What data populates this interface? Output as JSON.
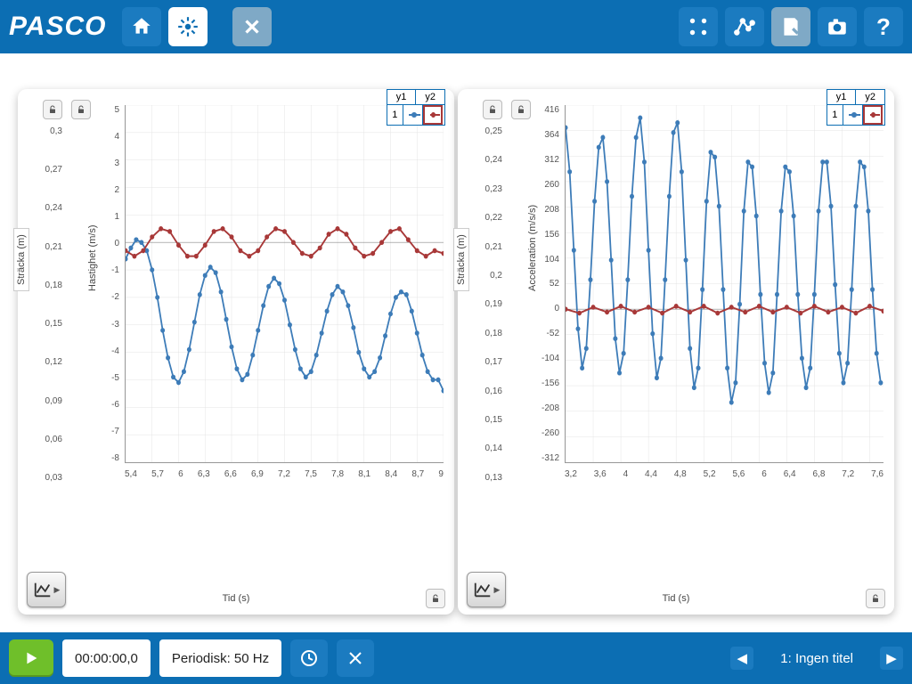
{
  "brand": "PASCO",
  "toolbar": {
    "home": "home-icon",
    "new": "new-icon",
    "close": "close-icon",
    "share": "share-icon",
    "draw": "draw-icon",
    "note": "note-icon",
    "camera": "camera-icon",
    "help": "?"
  },
  "bottom": {
    "time": "00:00:00,0",
    "mode": "Periodisk: 50 Hz",
    "page": "1: Ingen titel"
  },
  "chart_data": [
    {
      "type": "line",
      "title": "",
      "xlabel": "Tid (s)",
      "ylabel_left": "Sträcka (m)",
      "ylabel_right": "Hastighet (m/s)",
      "xlim": [
        5.4,
        9.0
      ],
      "ylim_right": [
        -8,
        5
      ],
      "ylim_left_ticks": [
        0.3,
        0.27,
        0.24,
        0.21,
        0.18,
        0.15,
        0.12,
        0.09,
        0.06,
        0.03
      ],
      "y_right_ticks": [
        5,
        4,
        3,
        2,
        1,
        0,
        -1,
        -2,
        -3,
        -4,
        -5,
        -6,
        -7,
        -8
      ],
      "x_ticks": [
        5.4,
        5.7,
        6.0,
        6.3,
        6.6,
        6.9,
        7.2,
        7.5,
        7.8,
        8.1,
        8.4,
        8.7,
        9.0
      ],
      "legend": {
        "headers": [
          "y1",
          "y2"
        ],
        "row_label": "1",
        "y1": "blue",
        "y2": "red"
      },
      "series": [
        {
          "name": "y1",
          "color": "#3d7cb8",
          "x": [
            5.4,
            5.46,
            5.52,
            5.58,
            5.64,
            5.7,
            5.76,
            5.82,
            5.88,
            5.94,
            6.0,
            6.06,
            6.12,
            6.18,
            6.24,
            6.3,
            6.36,
            6.42,
            6.48,
            6.54,
            6.6,
            6.66,
            6.72,
            6.78,
            6.84,
            6.9,
            6.96,
            7.02,
            7.08,
            7.14,
            7.2,
            7.26,
            7.32,
            7.38,
            7.44,
            7.5,
            7.56,
            7.62,
            7.68,
            7.74,
            7.8,
            7.86,
            7.92,
            7.98,
            8.04,
            8.1,
            8.16,
            8.22,
            8.28,
            8.34,
            8.4,
            8.46,
            8.52,
            8.58,
            8.64,
            8.7,
            8.76,
            8.82,
            8.88,
            8.94,
            9.0
          ],
          "values": [
            -0.6,
            -0.2,
            0.1,
            0.0,
            -0.3,
            -1.0,
            -2.0,
            -3.2,
            -4.2,
            -4.9,
            -5.1,
            -4.7,
            -3.9,
            -2.9,
            -1.9,
            -1.2,
            -0.9,
            -1.1,
            -1.8,
            -2.8,
            -3.8,
            -4.6,
            -5.0,
            -4.8,
            -4.1,
            -3.2,
            -2.3,
            -1.6,
            -1.3,
            -1.5,
            -2.1,
            -3.0,
            -3.9,
            -4.6,
            -4.9,
            -4.7,
            -4.1,
            -3.3,
            -2.5,
            -1.9,
            -1.6,
            -1.8,
            -2.3,
            -3.1,
            -4.0,
            -4.6,
            -4.9,
            -4.7,
            -4.2,
            -3.4,
            -2.6,
            -2.0,
            -1.8,
            -1.9,
            -2.5,
            -3.3,
            -4.1,
            -4.7,
            -5.0,
            -5.0,
            -5.4
          ]
        },
        {
          "name": "y2",
          "color": "#a83838",
          "x": [
            5.4,
            5.5,
            5.6,
            5.7,
            5.8,
            5.9,
            6.0,
            6.1,
            6.2,
            6.3,
            6.4,
            6.5,
            6.6,
            6.7,
            6.8,
            6.9,
            7.0,
            7.1,
            7.2,
            7.3,
            7.4,
            7.5,
            7.6,
            7.7,
            7.8,
            7.9,
            8.0,
            8.1,
            8.2,
            8.3,
            8.4,
            8.5,
            8.6,
            8.7,
            8.8,
            8.9,
            9.0
          ],
          "values": [
            -0.3,
            -0.5,
            -0.3,
            0.2,
            0.5,
            0.4,
            -0.1,
            -0.5,
            -0.5,
            -0.1,
            0.4,
            0.5,
            0.2,
            -0.3,
            -0.5,
            -0.3,
            0.2,
            0.5,
            0.4,
            0.0,
            -0.4,
            -0.5,
            -0.2,
            0.3,
            0.5,
            0.3,
            -0.2,
            -0.5,
            -0.4,
            0.0,
            0.4,
            0.5,
            0.1,
            -0.3,
            -0.5,
            -0.3,
            -0.4
          ]
        }
      ]
    },
    {
      "type": "line",
      "title": "",
      "xlabel": "Tid (s)",
      "ylabel_left": "Sträcka (m)",
      "ylabel_right": "Acceleration (m/s/s)",
      "xlim": [
        3.2,
        7.8
      ],
      "ylim_right": [
        -312,
        416
      ],
      "ylim_left_ticks": [
        0.25,
        0.24,
        0.23,
        0.22,
        0.21,
        0.2,
        0.19,
        0.18,
        0.17,
        0.16,
        0.15,
        0.14,
        0.13
      ],
      "y_right_ticks": [
        416,
        364,
        312,
        260,
        208,
        156,
        104,
        52,
        0,
        -52,
        -104,
        -156,
        -208,
        -260,
        -312
      ],
      "x_ticks": [
        3.2,
        3.6,
        4.0,
        4.4,
        4.8,
        5.2,
        5.6,
        6.0,
        6.4,
        6.8,
        7.2,
        7.6
      ],
      "legend": {
        "headers": [
          "y1",
          "y2"
        ],
        "row_label": "1",
        "y1": "blue",
        "y2": "red"
      },
      "series": [
        {
          "name": "y1",
          "color": "#3d7cb8",
          "x": [
            3.2,
            3.26,
            3.32,
            3.38,
            3.44,
            3.5,
            3.56,
            3.62,
            3.68,
            3.74,
            3.8,
            3.86,
            3.92,
            3.98,
            4.04,
            4.1,
            4.16,
            4.22,
            4.28,
            4.34,
            4.4,
            4.46,
            4.52,
            4.58,
            4.64,
            4.7,
            4.76,
            4.82,
            4.88,
            4.94,
            5.0,
            5.06,
            5.12,
            5.18,
            5.24,
            5.3,
            5.36,
            5.42,
            5.48,
            5.54,
            5.6,
            5.66,
            5.72,
            5.78,
            5.84,
            5.9,
            5.96,
            6.02,
            6.08,
            6.14,
            6.2,
            6.26,
            6.32,
            6.38,
            6.44,
            6.5,
            6.56,
            6.62,
            6.68,
            6.74,
            6.8,
            6.86,
            6.92,
            6.98,
            7.04,
            7.1,
            7.16,
            7.22,
            7.28,
            7.34,
            7.4,
            7.46,
            7.52,
            7.58,
            7.64,
            7.7,
            7.76
          ],
          "values": [
            370,
            280,
            120,
            -40,
            -120,
            -80,
            60,
            220,
            330,
            350,
            260,
            100,
            -60,
            -130,
            -90,
            60,
            230,
            350,
            390,
            300,
            120,
            -50,
            -140,
            -100,
            60,
            230,
            360,
            380,
            280,
            100,
            -80,
            -160,
            -120,
            40,
            220,
            320,
            310,
            210,
            40,
            -120,
            -190,
            -150,
            10,
            200,
            300,
            290,
            190,
            30,
            -110,
            -170,
            -130,
            30,
            200,
            290,
            280,
            190,
            30,
            -100,
            -160,
            -120,
            30,
            200,
            300,
            300,
            210,
            50,
            -90,
            -150,
            -110,
            40,
            210,
            300,
            290,
            200,
            40,
            -90,
            -150
          ]
        },
        {
          "name": "y2",
          "color": "#a83838",
          "x": [
            3.2,
            3.4,
            3.6,
            3.8,
            4.0,
            4.2,
            4.4,
            4.6,
            4.8,
            5.0,
            5.2,
            5.4,
            5.6,
            5.8,
            6.0,
            6.2,
            6.4,
            6.6,
            6.8,
            7.0,
            7.2,
            7.4,
            7.6,
            7.8
          ],
          "values": [
            0,
            -8,
            4,
            -6,
            6,
            -6,
            4,
            -8,
            6,
            -6,
            6,
            -8,
            4,
            -6,
            6,
            -6,
            4,
            -8,
            6,
            -6,
            4,
            -8,
            6,
            -4
          ]
        }
      ]
    }
  ]
}
